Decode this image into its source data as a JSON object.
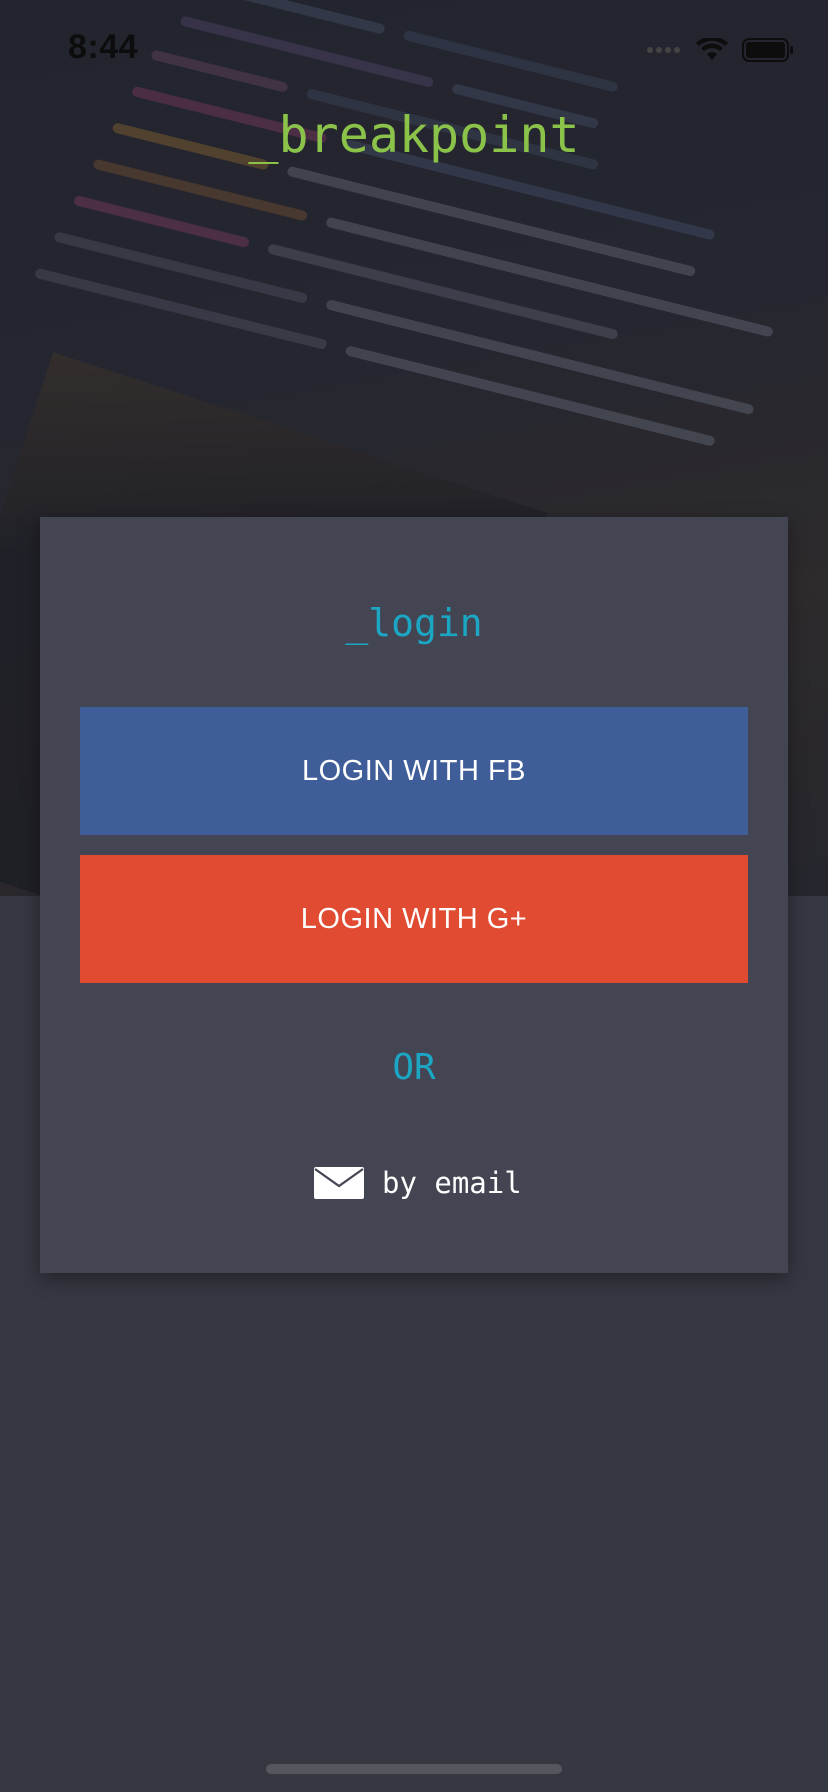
{
  "status_bar": {
    "time": "8:44",
    "icons": [
      "signal-icon",
      "wifi-icon",
      "battery-icon"
    ]
  },
  "app": {
    "brand": "_breakpoint"
  },
  "login_card": {
    "title": "_login",
    "facebook_button_label": "LOGIN WITH FB",
    "google_button_label": "LOGIN WITH G+",
    "or_label": "OR",
    "email_link_label": "by email",
    "email_icon": "envelope-icon"
  },
  "colors": {
    "brand_green": "#8bc34a",
    "accent_cyan": "#1ba7c4",
    "facebook_blue": "#3e5d99",
    "google_red": "#e04b32",
    "card_background": "#434552",
    "page_background": "#353741"
  }
}
